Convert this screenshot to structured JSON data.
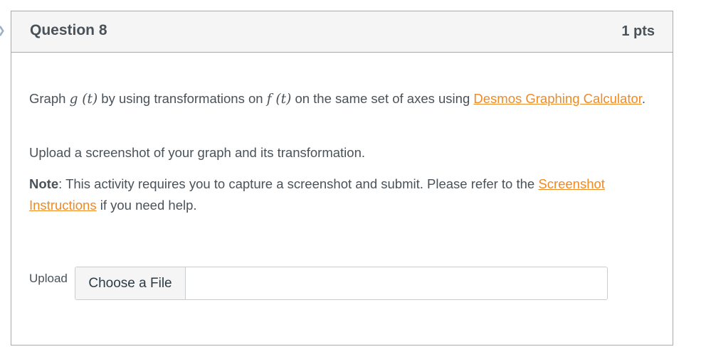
{
  "question": {
    "title": "Question 8",
    "points": "1 pts",
    "paragraph1": {
      "prefix": "Graph ",
      "math_g": "g (t)",
      "middle": " by using transformations on ",
      "math_f": "f (t)",
      "suffix": " on the same set of axes using ",
      "link": "Desmos Graphing Calculator",
      "end": "."
    },
    "paragraph2": "Upload a screenshot of your graph and its transformation.",
    "paragraph3": {
      "bold": "Note",
      "text": ": This activity requires you to capture a screenshot and submit. Please refer to the ",
      "link": "Screenshot Instructions",
      "end": " if you need help."
    },
    "upload": {
      "label": "Upload",
      "button": "Choose a File"
    }
  },
  "colors": {
    "link": "#f08a24",
    "header_bg": "#f5f5f5",
    "text": "#4a5259"
  }
}
